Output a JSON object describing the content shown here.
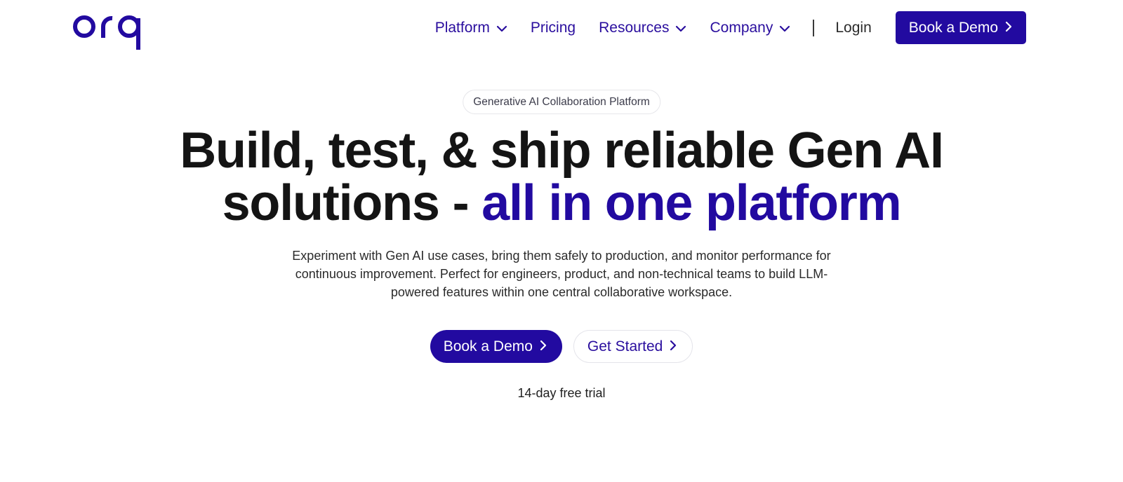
{
  "brand": {
    "name": "orq",
    "color": "#220aa0"
  },
  "nav": {
    "items": [
      {
        "label": "Platform",
        "has_dropdown": true
      },
      {
        "label": "Pricing",
        "has_dropdown": false
      },
      {
        "label": "Resources",
        "has_dropdown": true
      },
      {
        "label": "Company",
        "has_dropdown": true
      }
    ],
    "login_label": "Login",
    "cta_label": "Book a Demo",
    "chevron_icon": "chevron-down-icon",
    "cta_icon": "chevron-right-icon"
  },
  "hero": {
    "badge": "Generative AI Collaboration Platform",
    "headline_line1": "Build, test, & ship reliable Gen AI",
    "headline_line2_prefix": "solutions - ",
    "headline_line2_accent": "all in one platform",
    "subtext_line1": "Experiment with Gen AI use cases, bring them safely to production, and monitor performance for",
    "subtext_line2": "continuous improvement. Perfect for engineers, product, and non-technical teams to build LLM-",
    "subtext_line3": "powered features within one central collaborative workspace.",
    "primary_cta": "Book a Demo",
    "secondary_cta": "Get Started",
    "trial_note": "14-day free trial",
    "accent_color": "#220aa0"
  }
}
